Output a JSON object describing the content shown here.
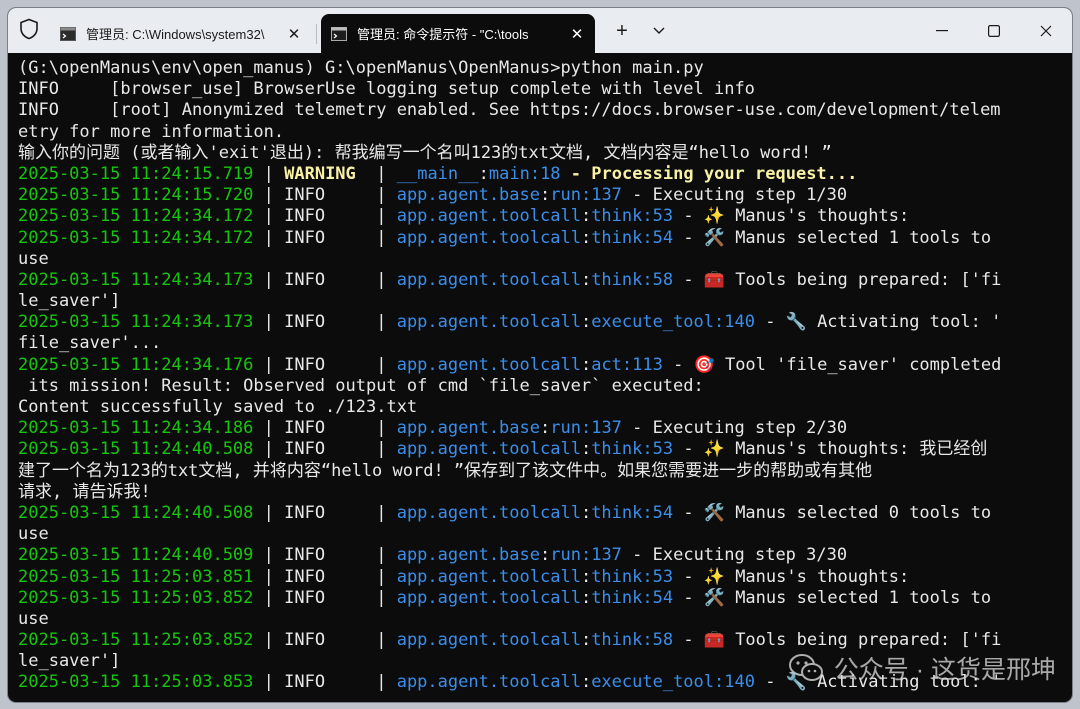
{
  "tabs": [
    {
      "label": "管理员: C:\\Windows\\system32\\"
    },
    {
      "label": "管理员: 命令提示符 - \"C:\\tools"
    }
  ],
  "titlebar": {
    "new_tab": "+",
    "dropdown": "⌄",
    "minimize": "—",
    "maximize": "□",
    "close": "✕"
  },
  "lines": [
    [
      {
        "t": "(G:\\openManus\\env\\open_manus) G:\\openManus\\OpenManus>python main.py"
      }
    ],
    [
      {
        "t": "INFO     [browser_use] BrowserUse logging setup complete with level info"
      }
    ],
    [
      {
        "t": "INFO     [root] Anonymized telemetry enabled. See https://docs.browser-use.com/development/telem"
      }
    ],
    [
      {
        "t": "etry for more information."
      }
    ],
    [
      {
        "t": "输入你的问题 (或者输入'exit'退出): 帮我编写一个名叫123的txt文档, 文档内容是“hello word! ”"
      }
    ],
    [
      {
        "t": "2025-03-15 11:24:15.719",
        "c": "ts"
      },
      {
        "t": " | "
      },
      {
        "t": "WARNING",
        "c": "warn"
      },
      {
        "t": "  | "
      },
      {
        "t": "__main__",
        "c": "mod"
      },
      {
        "t": ":"
      },
      {
        "t": "main",
        "c": "mod"
      },
      {
        "t": ":18",
        "c": "mod"
      },
      {
        "t": " - ",
        "c": "warn"
      },
      {
        "t": "Processing your request...",
        "c": "warn"
      }
    ],
    [
      {
        "t": "2025-03-15 11:24:15.720",
        "c": "ts"
      },
      {
        "t": " | INFO     | "
      },
      {
        "t": "app.agent.base",
        "c": "mod"
      },
      {
        "t": ":"
      },
      {
        "t": "run",
        "c": "mod"
      },
      {
        "t": ":137",
        "c": "mod"
      },
      {
        "t": " - Executing step 1/30"
      }
    ],
    [
      {
        "t": "2025-03-15 11:24:34.172",
        "c": "ts"
      },
      {
        "t": " | INFO     | "
      },
      {
        "t": "app.agent.toolcall",
        "c": "mod"
      },
      {
        "t": ":"
      },
      {
        "t": "think",
        "c": "mod"
      },
      {
        "t": ":53",
        "c": "mod"
      },
      {
        "t": " - ✨ Manus's thoughts:"
      }
    ],
    [
      {
        "t": "2025-03-15 11:24:34.172",
        "c": "ts"
      },
      {
        "t": " | INFO     | "
      },
      {
        "t": "app.agent.toolcall",
        "c": "mod"
      },
      {
        "t": ":"
      },
      {
        "t": "think",
        "c": "mod"
      },
      {
        "t": ":54",
        "c": "mod"
      },
      {
        "t": " - 🛠️ Manus selected 1 tools to"
      }
    ],
    [
      {
        "t": "use"
      }
    ],
    [
      {
        "t": "2025-03-15 11:24:34.173",
        "c": "ts"
      },
      {
        "t": " | INFO     | "
      },
      {
        "t": "app.agent.toolcall",
        "c": "mod"
      },
      {
        "t": ":"
      },
      {
        "t": "think",
        "c": "mod"
      },
      {
        "t": ":58",
        "c": "mod"
      },
      {
        "t": " - 🧰 Tools being prepared: ['fi"
      }
    ],
    [
      {
        "t": "le_saver']"
      }
    ],
    [
      {
        "t": "2025-03-15 11:24:34.173",
        "c": "ts"
      },
      {
        "t": " | INFO     | "
      },
      {
        "t": "app.agent.toolcall",
        "c": "mod"
      },
      {
        "t": ":"
      },
      {
        "t": "execute_tool",
        "c": "mod"
      },
      {
        "t": ":140",
        "c": "mod"
      },
      {
        "t": " - 🔧 Activating tool: '"
      }
    ],
    [
      {
        "t": "file_saver'..."
      }
    ],
    [
      {
        "t": "2025-03-15 11:24:34.176",
        "c": "ts"
      },
      {
        "t": " | INFO     | "
      },
      {
        "t": "app.agent.toolcall",
        "c": "mod"
      },
      {
        "t": ":"
      },
      {
        "t": "act",
        "c": "mod"
      },
      {
        "t": ":113",
        "c": "mod"
      },
      {
        "t": " - 🎯 Tool 'file_saver' completed"
      }
    ],
    [
      {
        "t": " its mission! Result: Observed output of cmd `file_saver` executed:"
      }
    ],
    [
      {
        "t": "Content successfully saved to ./123.txt"
      }
    ],
    [
      {
        "t": "2025-03-15 11:24:34.186",
        "c": "ts"
      },
      {
        "t": " | INFO     | "
      },
      {
        "t": "app.agent.base",
        "c": "mod"
      },
      {
        "t": ":"
      },
      {
        "t": "run",
        "c": "mod"
      },
      {
        "t": ":137",
        "c": "mod"
      },
      {
        "t": " - Executing step 2/30"
      }
    ],
    [
      {
        "t": "2025-03-15 11:24:40.508",
        "c": "ts"
      },
      {
        "t": " | INFO     | "
      },
      {
        "t": "app.agent.toolcall",
        "c": "mod"
      },
      {
        "t": ":"
      },
      {
        "t": "think",
        "c": "mod"
      },
      {
        "t": ":53",
        "c": "mod"
      },
      {
        "t": " - ✨ Manus's thoughts: 我已经创"
      }
    ],
    [
      {
        "t": "建了一个名为123的txt文档, 并将内容“hello word! ”保存到了该文件中。如果您需要进一步的帮助或有其他"
      }
    ],
    [
      {
        "t": "请求, 请告诉我!"
      }
    ],
    [
      {
        "t": "2025-03-15 11:24:40.508",
        "c": "ts"
      },
      {
        "t": " | INFO     | "
      },
      {
        "t": "app.agent.toolcall",
        "c": "mod"
      },
      {
        "t": ":"
      },
      {
        "t": "think",
        "c": "mod"
      },
      {
        "t": ":54",
        "c": "mod"
      },
      {
        "t": " - 🛠️ Manus selected 0 tools to"
      }
    ],
    [
      {
        "t": "use"
      }
    ],
    [
      {
        "t": "2025-03-15 11:24:40.509",
        "c": "ts"
      },
      {
        "t": " | INFO     | "
      },
      {
        "t": "app.agent.base",
        "c": "mod"
      },
      {
        "t": ":"
      },
      {
        "t": "run",
        "c": "mod"
      },
      {
        "t": ":137",
        "c": "mod"
      },
      {
        "t": " - Executing step 3/30"
      }
    ],
    [
      {
        "t": "2025-03-15 11:25:03.851",
        "c": "ts"
      },
      {
        "t": " | INFO     | "
      },
      {
        "t": "app.agent.toolcall",
        "c": "mod"
      },
      {
        "t": ":"
      },
      {
        "t": "think",
        "c": "mod"
      },
      {
        "t": ":53",
        "c": "mod"
      },
      {
        "t": " - ✨ Manus's thoughts:"
      }
    ],
    [
      {
        "t": "2025-03-15 11:25:03.852",
        "c": "ts"
      },
      {
        "t": " | INFO     | "
      },
      {
        "t": "app.agent.toolcall",
        "c": "mod"
      },
      {
        "t": ":"
      },
      {
        "t": "think",
        "c": "mod"
      },
      {
        "t": ":54",
        "c": "mod"
      },
      {
        "t": " - 🛠️ Manus selected 1 tools to"
      }
    ],
    [
      {
        "t": "use"
      }
    ],
    [
      {
        "t": "2025-03-15 11:25:03.852",
        "c": "ts"
      },
      {
        "t": " | INFO     | "
      },
      {
        "t": "app.agent.toolcall",
        "c": "mod"
      },
      {
        "t": ":"
      },
      {
        "t": "think",
        "c": "mod"
      },
      {
        "t": ":58",
        "c": "mod"
      },
      {
        "t": " - 🧰 Tools being prepared: ['fi"
      }
    ],
    [
      {
        "t": "le_saver']"
      }
    ],
    [
      {
        "t": "2025-03-15 11:25:03.853",
        "c": "ts"
      },
      {
        "t": " | INFO     | "
      },
      {
        "t": "app.agent.toolcall",
        "c": "mod"
      },
      {
        "t": ":"
      },
      {
        "t": "execute_tool",
        "c": "mod"
      },
      {
        "t": ":140",
        "c": "mod"
      },
      {
        "t": " - 🔧 Activating tool: '"
      }
    ]
  ],
  "watermark": {
    "text": "公众号 · 这货是邢坤"
  },
  "colors": {
    "timestamp": "#16c60c",
    "warning": "#f9f1a5",
    "module": "#3b8eea",
    "text": "#e8e8e8",
    "background": "#0c0c0c"
  },
  "icons": [
    "shield-icon",
    "terminal-icon",
    "close-icon",
    "plus-icon",
    "chevron-down-icon",
    "minimize-icon",
    "maximize-icon",
    "wechat-icon"
  ]
}
